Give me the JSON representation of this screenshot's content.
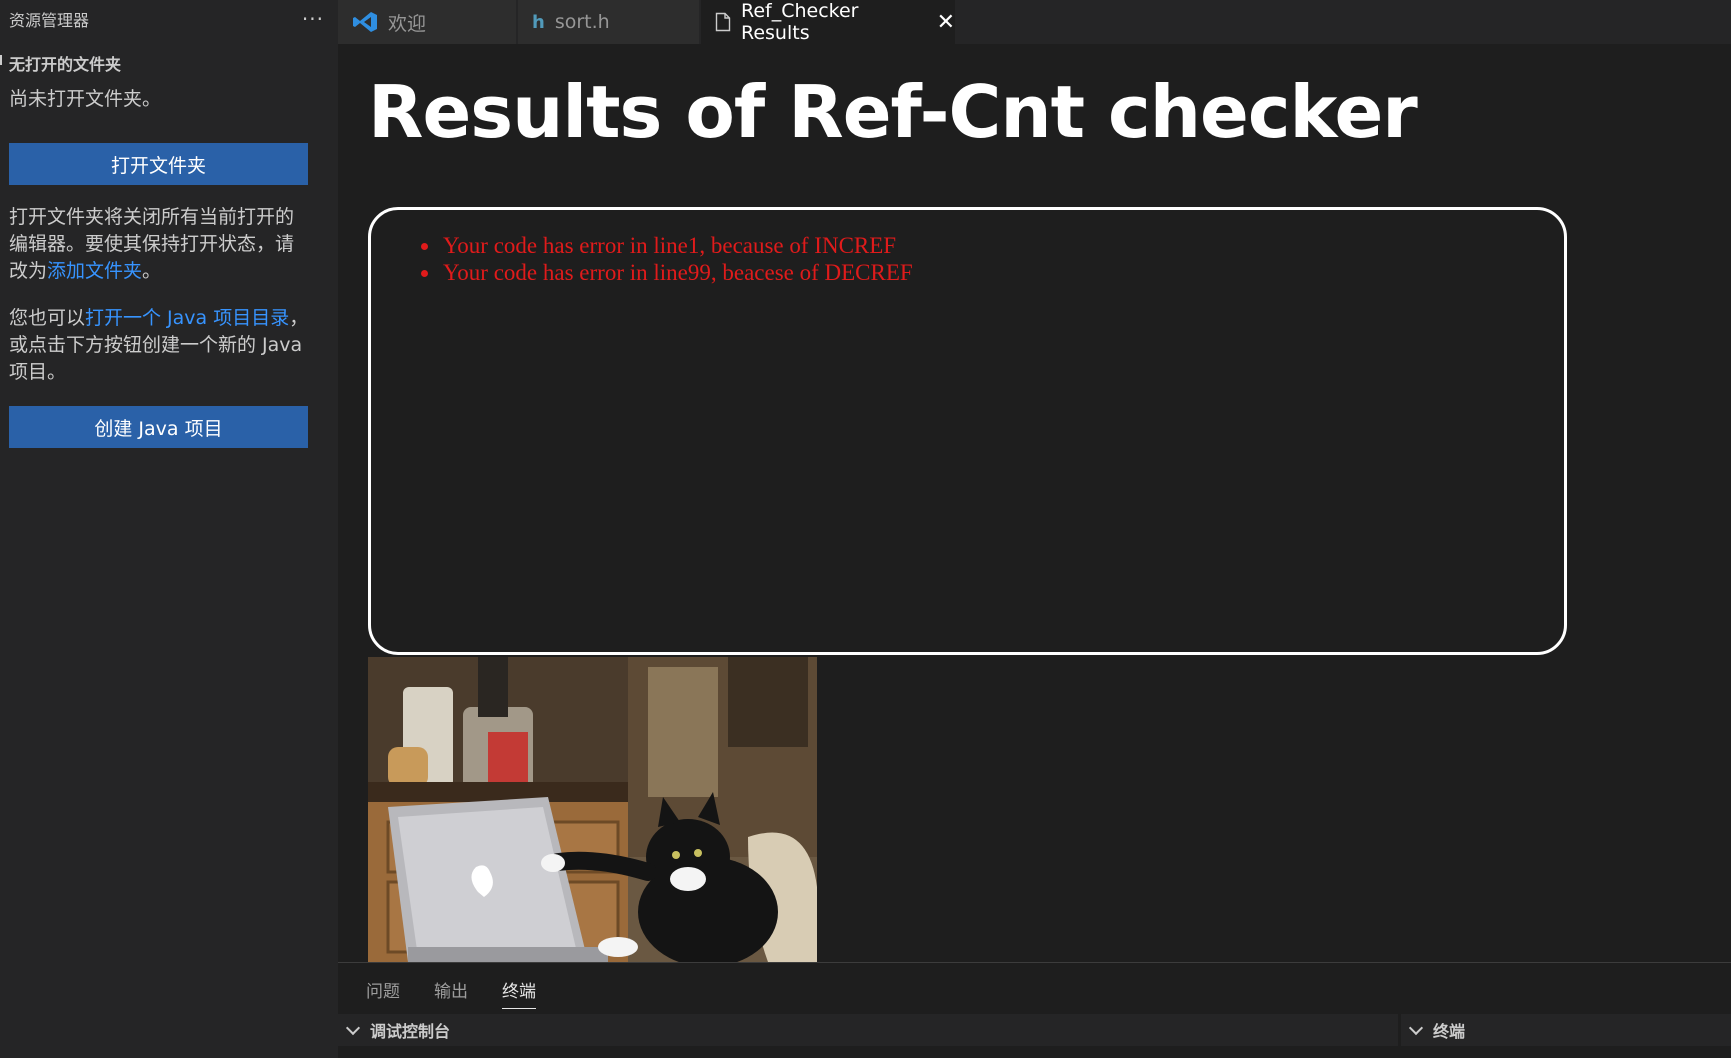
{
  "sidebar": {
    "title": "资源管理器",
    "more_icon": "ellipsis-icon",
    "section_title": "无打开的文件夹",
    "no_folder_text": "尚未打开文件夹。",
    "open_folder_button": "打开文件夹",
    "info_part1": "打开文件夹将关闭所有当前打开的编辑器。要使其保持打开状态，请改为",
    "info_link": "添加文件夹",
    "info_part2": "。",
    "java_part1": "您也可以",
    "java_link": "打开一个 Java 项目目录",
    "java_part2": "，或点击下方按钮创建一个新的 Java 项目。",
    "create_java_button": "创建 Java 项目"
  },
  "tabs": [
    {
      "label": "欢迎",
      "icon": "vscode-icon"
    },
    {
      "label": "sort.h",
      "icon": "h-file-icon"
    },
    {
      "label": "Ref_Checker Results",
      "icon": "file-icon",
      "active": true
    }
  ],
  "editor": {
    "heading": "Results of Ref-Cnt checker",
    "errors": [
      "Your code has error in line1, because of INCREF",
      "Your code has error in line99, beacese of DECREF"
    ],
    "error_color": "#e01b1b"
  },
  "panel": {
    "tabs": [
      "问题",
      "输出",
      "终端"
    ],
    "active_tab": "终端",
    "debug_console": "调试控制台",
    "terminal": "终端"
  },
  "colors": {
    "accent_button": "#2a61a8",
    "link": "#3794ff"
  }
}
